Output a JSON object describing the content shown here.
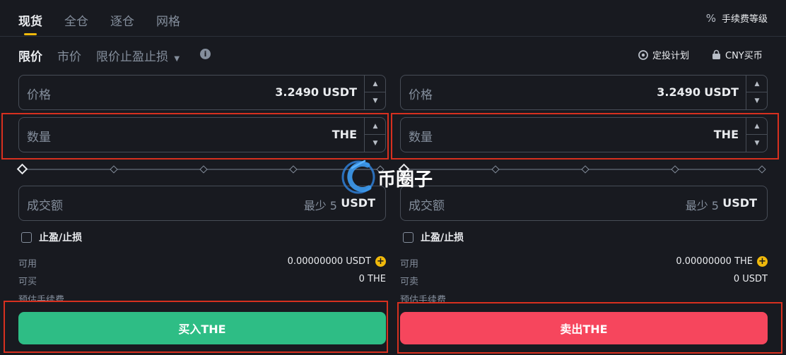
{
  "tabs": [
    "现货",
    "全仓",
    "逐仓",
    "网格"
  ],
  "fee_level": "手续费等级",
  "order_types": [
    "限价",
    "市价",
    "限价止盈止损"
  ],
  "dca_plan": "定投计划",
  "cny_buy": "CNY买币",
  "buy": {
    "price_label": "价格",
    "price_value": "3.2490",
    "price_unit": "USDT",
    "qty_label": "数量",
    "qty_unit": "THE",
    "total_label": "成交额",
    "total_min": "最少 5",
    "total_unit": "USDT",
    "tpsl_label": "止盈/止损",
    "avail_label": "可用",
    "avail_value": "0.00000000 USDT",
    "can_label": "可买",
    "can_value": "0 THE",
    "fee_label": "预估手续费",
    "button": "买入THE"
  },
  "sell": {
    "price_label": "价格",
    "price_value": "3.2490",
    "price_unit": "USDT",
    "qty_label": "数量",
    "qty_unit": "THE",
    "total_label": "成交额",
    "total_min": "最少 5",
    "total_unit": "USDT",
    "tpsl_label": "止盈/止损",
    "avail_label": "可用",
    "avail_value": "0.00000000 THE",
    "can_label": "可卖",
    "can_value": "0 USDT",
    "fee_label": "预估手续费",
    "button": "卖出THE"
  },
  "watermark": "币圈子",
  "colors": {
    "background": "#181a20",
    "accent": "#f0b90b",
    "buy": "#2ebd85",
    "sell": "#f6465d",
    "highlight": "#d7301f"
  }
}
